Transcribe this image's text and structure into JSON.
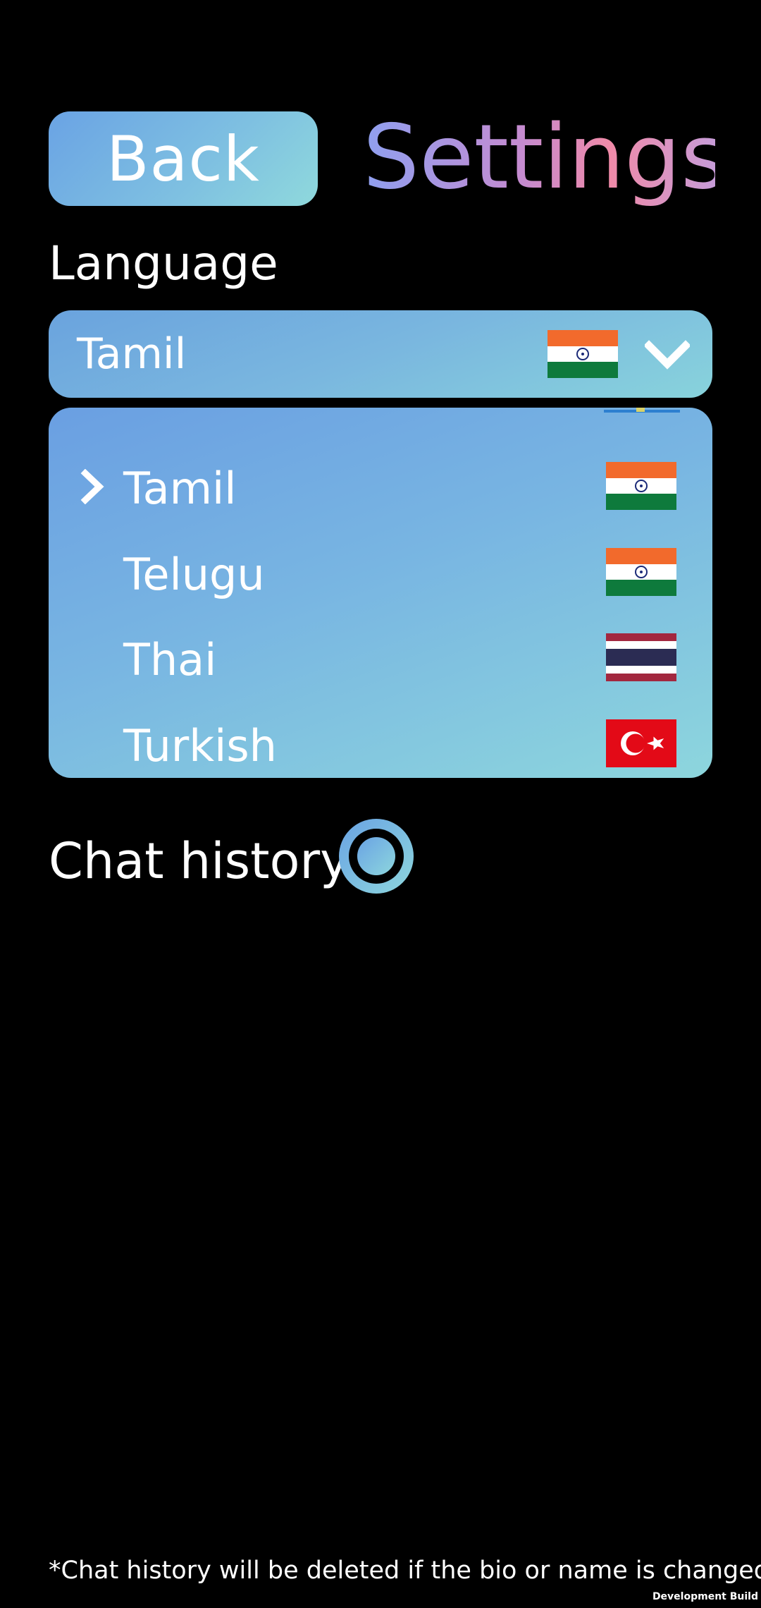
{
  "header": {
    "back_label": "Back",
    "title": "Settings"
  },
  "language": {
    "label": "Language",
    "selected": "Tamil",
    "selected_flag": "india-flag-icon",
    "options": [
      {
        "label": "Tamil",
        "flag": "india-flag-icon",
        "selected": true
      },
      {
        "label": "Telugu",
        "flag": "india-flag-icon",
        "selected": false
      },
      {
        "label": "Thai",
        "flag": "thailand-flag-icon",
        "selected": false
      },
      {
        "label": "Turkish",
        "flag": "turkey-flag-icon",
        "selected": false
      }
    ]
  },
  "chat_history": {
    "label": "Chat history"
  },
  "footnote": "*Chat history will be deleted if the bio or name is changed",
  "build_label": "Development Build",
  "colors": {
    "background": "#000000",
    "accent_blue": "#6aa3e4",
    "accent_teal": "#8dd6dd",
    "title_pink": "#f08aa8"
  }
}
